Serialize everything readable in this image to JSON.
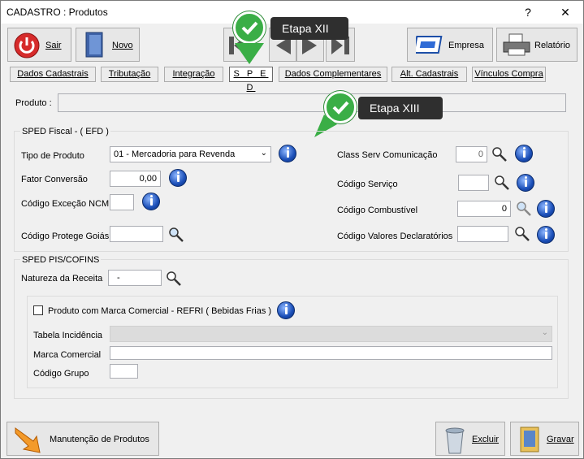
{
  "window": {
    "title": "CADASTRO : Produtos",
    "help": "?",
    "close": "✕"
  },
  "toolbar": {
    "sair": "Sair",
    "novo": "Novo",
    "empresa": "Empresa",
    "relatorio": "Relatório"
  },
  "tabs": [
    "Dados Cadastrais",
    "Tributação",
    "Integração",
    "S P E D",
    "Dados Complementares",
    "Alt. Cadastrais",
    "Vínculos Compra"
  ],
  "callouts": {
    "xii": "Etapa XII",
    "xiii": "Etapa XIII"
  },
  "produto": {
    "label": "Produto :",
    "value": ""
  },
  "sped_fiscal": {
    "title": "SPED Fiscal  -  ( EFD )",
    "tipo_label": "Tipo de Produto",
    "tipo_value": "01 - Mercadoria para Revenda",
    "fator_label": "Fator Conversão",
    "fator_value": "0,00",
    "ncm_label": "Código Exceção NCM",
    "ncm_value": "",
    "goias_label": "Código Protege Goiás",
    "goias_value": "",
    "class_label": "Class Serv Comunicação",
    "class_value": "0",
    "servico_label": "Código Serviço",
    "servico_value": "",
    "comb_label": "Código Combustível",
    "comb_value": "0",
    "valores_label": "Código Valores Declaratórios",
    "valores_value": ""
  },
  "sped_pis": {
    "title": "SPED PIS/COFINS",
    "natureza_label": "Natureza da Receita",
    "natureza_value": "-",
    "refri_label": "Produto com Marca Comercial - REFRI ( Bebidas Frias )",
    "tabela_label": "Tabela Incidência",
    "marca_label": "Marca Comercial",
    "grupo_label": "Código Grupo"
  },
  "footer": {
    "manutencao": "Manutenção de Produtos",
    "excluir": "Excluir",
    "gravar": "Gravar"
  }
}
